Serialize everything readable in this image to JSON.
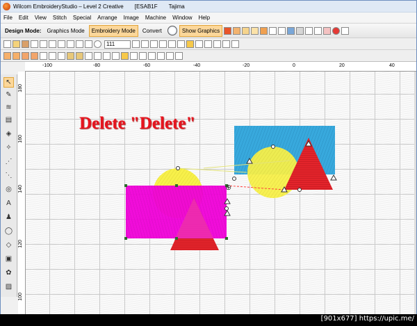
{
  "window": {
    "app_name": "Wilcom EmbroideryStudio – Level 2 Creative",
    "document": "[ESAB1F",
    "machine": "Tajima"
  },
  "menu": [
    "File",
    "Edit",
    "View",
    "Stitch",
    "Special",
    "Arrange",
    "Image",
    "Machine",
    "Window",
    "Help"
  ],
  "toolbar": {
    "design_mode_label": "Design Mode:",
    "graphics_mode": "Graphics Mode",
    "embroidery_mode": "Embroidery Mode",
    "convert": "Convert",
    "show_graphics": "Show Graphics",
    "zoom_value": "111"
  },
  "rulers": {
    "horizontal": [
      "-100",
      "-80",
      "-60",
      "-40",
      "-20",
      "0",
      "20",
      "40"
    ],
    "vertical": [
      "180",
      "160",
      "140",
      "120",
      "100"
    ]
  },
  "canvas": {
    "annotation": "Delete \"Delete\"",
    "colors": {
      "magenta": "#f000d8",
      "yellow": "#f7f04a",
      "red": "#e3242b",
      "cyan": "#38a9dd",
      "handle_line": "#ff3b3b"
    }
  },
  "icons": [
    "pointer-icon",
    "reshape-icon",
    "stitch-icon",
    "fill-icon",
    "outline-icon",
    "text-icon",
    "monogram-icon",
    "applique-icon",
    "ellipse-icon",
    "rectangle-icon",
    "flower-icon",
    "layers-icon"
  ],
  "watermark": "[901x677] https://upic.me/"
}
